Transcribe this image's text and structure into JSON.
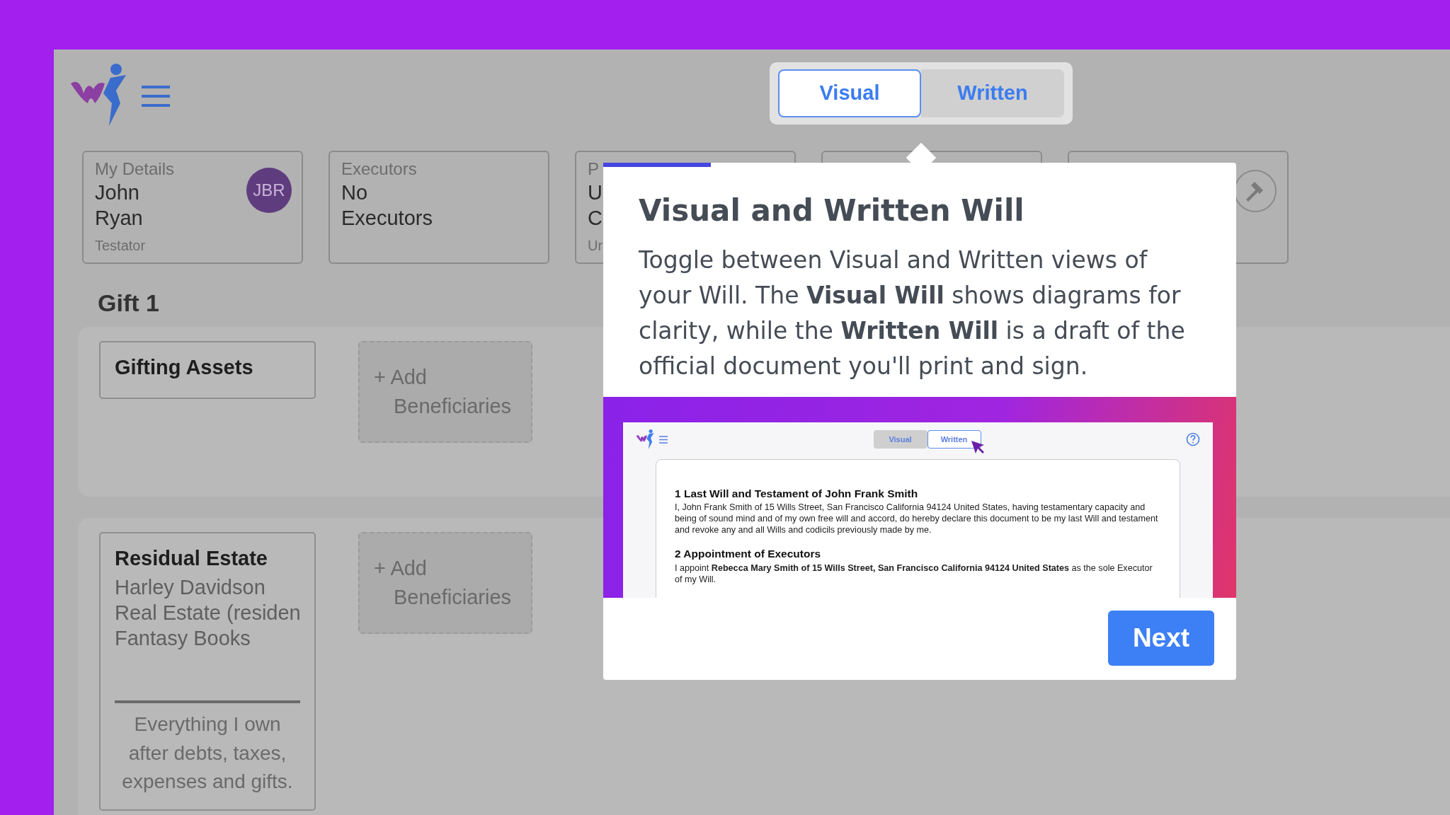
{
  "header": {
    "view_toggle": [
      {
        "label": "Visual",
        "selected": true
      },
      {
        "label": "Written",
        "selected": false
      }
    ]
  },
  "summary_cards": [
    {
      "kind": "person",
      "label": "My Details",
      "lines": [
        "John",
        "Ryan"
      ],
      "caption": "Testator",
      "avatar": "JBR"
    },
    {
      "kind": "text",
      "label": "Executors",
      "lines": [
        "No",
        "Executors"
      ]
    },
    {
      "kind": "text",
      "label": "P",
      "lines": [
        "U",
        "C"
      ],
      "caption": "Ur"
    },
    {
      "kind": "blank"
    },
    {
      "kind": "gavel"
    }
  ],
  "gifts": [
    {
      "heading": "Gift 1",
      "asset_title": "Gifting Assets",
      "add_button": "+ Add Beneficiaries"
    },
    {
      "asset_title": "Residual Estate",
      "assets": [
        "Harley Davidson",
        "Real Estate (residen",
        "Fantasy Books"
      ],
      "note": "Everything I own after debts, taxes, expenses and gifts.",
      "add_button": "+ Add Beneficiaries"
    }
  ],
  "tour_popover": {
    "progress": {
      "level": 0.17
    },
    "title": "Visual and Written Will",
    "body": "Toggle between Visual and Written views of your Will. The **Visual Will** shows diagrams for clarity, while the **Written Will** is a draft of the official document you'll print and sign.",
    "preview": {
      "view_toggle": [
        {
          "label": "Visual",
          "selected": false
        },
        {
          "label": "Written",
          "selected": true
        }
      ],
      "sections": [
        {
          "heading": "1 Last Will and Testament of John Frank Smith",
          "text": "I, John Frank Smith of 15 Wills Street, San Francisco California 94124 United States, having testamentary capacity and being of sound mind and of my own free will and accord, do hereby declare this document to be my last Will and testament and revoke any and all Wills and codicils previously made by me."
        },
        {
          "heading": "2 Appointment of Executors",
          "text": "I appoint **Rebecca Mary Smith of 15 Wills Street, San Francisco California 94124 United States** as the sole Executor of my Will."
        }
      ]
    },
    "next_button": "Next"
  }
}
